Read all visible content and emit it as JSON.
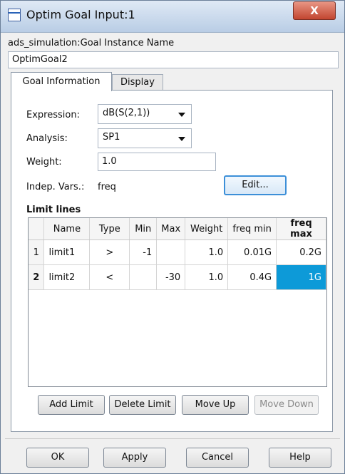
{
  "window": {
    "title": "Optim Goal Input:1",
    "close_glyph": "X"
  },
  "instance": {
    "label": "ads_simulation:Goal Instance Name",
    "value": "OptimGoal2"
  },
  "tabs": [
    {
      "label": "Goal Information",
      "active": true
    },
    {
      "label": "Display",
      "active": false
    }
  ],
  "goal": {
    "expression_label": "Expression:",
    "expression_value": "dB(S(2,1))",
    "analysis_label": "Analysis:",
    "analysis_value": "SP1",
    "weight_label": "Weight:",
    "weight_value": "1.0",
    "indep_label": "Indep. Vars.:",
    "indep_value": "freq",
    "edit_button": "Edit..."
  },
  "limit_lines": {
    "title": "Limit lines",
    "columns": [
      "Name",
      "Type",
      "Min",
      "Max",
      "Weight",
      "freq min",
      "freq max"
    ],
    "rows": [
      {
        "index": "1",
        "name": "limit1",
        "type": ">",
        "min": "-1",
        "max": "",
        "weight": "1.0",
        "freq_min": "0.01G",
        "freq_max": "0.2G"
      },
      {
        "index": "2",
        "name": "limit2",
        "type": "<",
        "min": "",
        "max": "-30",
        "weight": "1.0",
        "freq_min": "0.4G",
        "freq_max": "1G"
      }
    ],
    "selected_row": 2,
    "selected_column": "freq max",
    "selection_color": "#0d9ad8"
  },
  "limit_buttons": {
    "add": "Add Limit",
    "delete": "Delete Limit",
    "move_up": "Move Up",
    "move_down": "Move Down"
  },
  "footer": {
    "ok": "OK",
    "apply": "Apply",
    "cancel": "Cancel",
    "help": "Help"
  }
}
